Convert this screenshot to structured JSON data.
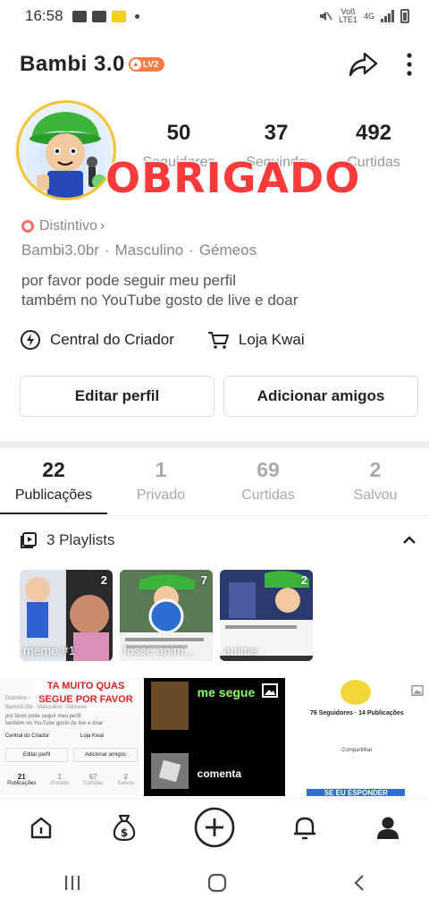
{
  "status_bar": {
    "time": "16:58",
    "net_top": "Voß",
    "net_bottom": "LTE1",
    "net_type": "4G"
  },
  "header": {
    "title": "Bambi 3.0",
    "level": "LV2"
  },
  "stats": [
    {
      "value": "50",
      "label": "Seguidores"
    },
    {
      "value": "37",
      "label": "Seguindo"
    },
    {
      "value": "492",
      "label": "Curtidas"
    }
  ],
  "overlay_text": "OBRIGADO",
  "profile": {
    "badge": "Distintivo",
    "badge_chevron": "›",
    "username": "Bambi3.0br",
    "gender": "Masculino",
    "sign": "Gémeos",
    "separator": "·",
    "bio_line1": "por favor pode seguir meu perfil",
    "bio_line2": "também no YouTube gosto de live e doar"
  },
  "creator_row": {
    "creator_center": "Central do Criador",
    "shop": "Loja Kwai"
  },
  "buttons": {
    "edit_profile": "Editar perfil",
    "add_friends": "Adicionar amigos"
  },
  "tabs": [
    {
      "count": "22",
      "label": "Publicações",
      "active": true
    },
    {
      "count": "1",
      "label": "Privado",
      "active": false
    },
    {
      "count": "69",
      "label": "Curtidas",
      "active": false
    },
    {
      "count": "2",
      "label": "Salvou",
      "active": false
    }
  ],
  "playlists": {
    "header": "3 Playlists",
    "items": [
      {
        "name": "meme #1",
        "count": "2"
      },
      {
        "name": "fosse anim...",
        "count": "7"
      },
      {
        "name": "anime",
        "count": "2"
      }
    ]
  },
  "grid": {
    "item1": {
      "banner_line1": "TA MUITO QUAS",
      "banner_line2": "SEGUE POR FAVOR",
      "mini_badge": "Distintivo ›",
      "mini_info": "Bambi3.0br · Masculino · Gêmeos",
      "mini_bio1": "por favor pode seguir meu perfil",
      "mini_bio2": "também no YouTube gosto de live e doar",
      "mini_creator": "Central do Criador",
      "mini_shop": "Loja Kwai",
      "mini_edit": "Editar perfil",
      "mini_add": "Adicionar amigos",
      "mini_tabs": [
        {
          "n": "21",
          "l": "Publicações"
        },
        {
          "n": "1",
          "l": "Privado"
        },
        {
          "n": "67",
          "l": "Curtidas"
        },
        {
          "n": "2",
          "l": "Salvou"
        }
      ]
    },
    "item2": {
      "line1": "me segue",
      "line2": "comenta"
    },
    "item3": {
      "stats": "76 Seguidores · 14 Publicações",
      "share": "Compartilhar",
      "banner": "SE EU ESPONDER"
    }
  },
  "colors": {
    "accent": "#ff7a45",
    "overlay_red": "#ff3a3a",
    "inactive": "#aaaaaa"
  },
  "icons": {
    "bottom_nav": [
      "home-icon",
      "money-bag-icon",
      "plus-icon",
      "bell-icon",
      "profile-icon"
    ],
    "system_nav": [
      "recents-icon",
      "home-circle-icon",
      "back-icon"
    ]
  }
}
